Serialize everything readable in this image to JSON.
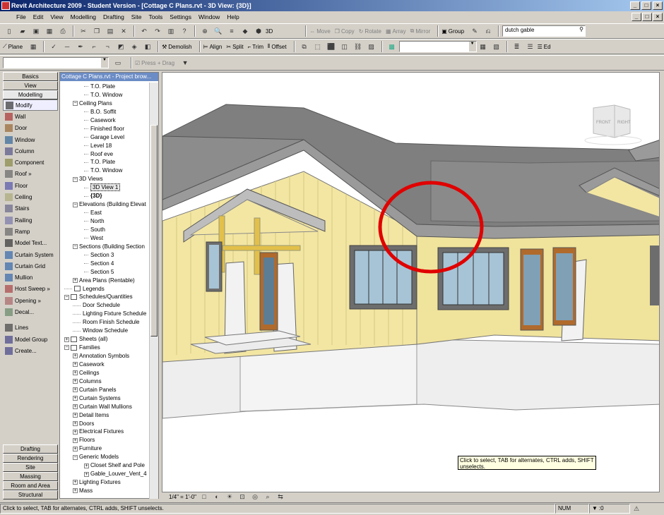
{
  "window": {
    "title": "Revit Architecture 2009 - Student Version - [Cottage C Plans.rvt - 3D View: {3D}]"
  },
  "menu": [
    "File",
    "Edit",
    "View",
    "Modelling",
    "Drafting",
    "Site",
    "Tools",
    "Settings",
    "Window",
    "Help"
  ],
  "toolbar1": {
    "view3d_label": "3D",
    "move": "Move",
    "copy": "Copy",
    "rotate": "Rotate",
    "array": "Array",
    "mirror": "Mirror",
    "group": "Group",
    "search_value": "dutch gable"
  },
  "toolbar2": {
    "plane": "Plane",
    "demolish": "Demolish",
    "align": "Align",
    "split": "Split",
    "trim": "Trim",
    "offset": "Offset",
    "ed": "Ed"
  },
  "toolbar3": {
    "press_drag": "Press + Drag"
  },
  "design_bar": {
    "top_tabs": [
      "Basics",
      "View",
      "Modelling"
    ],
    "items": [
      "Modify",
      "Wall",
      "Door",
      "Window",
      "Column",
      "Component",
      "Roof »",
      "Floor",
      "Ceiling",
      "Stairs",
      "Railing",
      "Ramp",
      "Model Text...",
      "Curtain System",
      "Curtain Grid",
      "Mullion",
      "Host Sweep »",
      "Opening »",
      "Decal...",
      "Lines",
      "Model Group",
      "Create..."
    ],
    "bottom_tabs": [
      "Drafting",
      "Rendering",
      "Site",
      "Massing",
      "Room and Area",
      "Structural"
    ]
  },
  "browser": {
    "header": "Cottage C Plans.rvt - Project brow...",
    "nodes": [
      {
        "t": "T.O. Plate",
        "l": 3
      },
      {
        "t": "T.O. Window",
        "l": 3
      },
      {
        "t": "Ceiling Plans",
        "l": 2,
        "e": "−"
      },
      {
        "t": "B.O. Soffit",
        "l": 3
      },
      {
        "t": "Casework",
        "l": 3
      },
      {
        "t": "Finished floor",
        "l": 3
      },
      {
        "t": "Garage Level",
        "l": 3
      },
      {
        "t": "Level 18",
        "l": 3
      },
      {
        "t": "Roof eve",
        "l": 3
      },
      {
        "t": "T.O. Plate",
        "l": 3
      },
      {
        "t": "T.O. Window",
        "l": 3
      },
      {
        "t": "3D Views",
        "l": 2,
        "e": "−"
      },
      {
        "t": "3D View 1",
        "l": 3,
        "sel": true
      },
      {
        "t": "{3D}",
        "l": 3,
        "bold": true
      },
      {
        "t": "Elevations (Building Elevat",
        "l": 2,
        "e": "−"
      },
      {
        "t": "East",
        "l": 3
      },
      {
        "t": "North",
        "l": 3
      },
      {
        "t": "South",
        "l": 3
      },
      {
        "t": "West",
        "l": 3
      },
      {
        "t": "Sections (Building Section",
        "l": 2,
        "e": "−"
      },
      {
        "t": "Section 3",
        "l": 3
      },
      {
        "t": "Section 4",
        "l": 3
      },
      {
        "t": "Section 5",
        "l": 3
      },
      {
        "t": "Area Plans (Rentable)",
        "l": 2,
        "e": "+"
      },
      {
        "t": "Legends",
        "l": 1,
        "icon": true
      },
      {
        "t": "Schedules/Quantities",
        "l": 1,
        "e": "−",
        "icon": true
      },
      {
        "t": "Door Schedule",
        "l": 2
      },
      {
        "t": "Lighting Fixture Schedule",
        "l": 2
      },
      {
        "t": "Room Finish Schedule",
        "l": 2
      },
      {
        "t": "Window Schedule",
        "l": 2
      },
      {
        "t": "Sheets (all)",
        "l": 1,
        "e": "+",
        "icon": true
      },
      {
        "t": "Families",
        "l": 1,
        "e": "−",
        "icon": true
      },
      {
        "t": "Annotation Symbols",
        "l": 2,
        "e": "+"
      },
      {
        "t": "Casework",
        "l": 2,
        "e": "+"
      },
      {
        "t": "Ceilings",
        "l": 2,
        "e": "+"
      },
      {
        "t": "Columns",
        "l": 2,
        "e": "+"
      },
      {
        "t": "Curtain Panels",
        "l": 2,
        "e": "+"
      },
      {
        "t": "Curtain Systems",
        "l": 2,
        "e": "+"
      },
      {
        "t": "Curtain Wall Mullions",
        "l": 2,
        "e": "+"
      },
      {
        "t": "Detail Items",
        "l": 2,
        "e": "+"
      },
      {
        "t": "Doors",
        "l": 2,
        "e": "+"
      },
      {
        "t": "Electrical Fixtures",
        "l": 2,
        "e": "+"
      },
      {
        "t": "Floors",
        "l": 2,
        "e": "+"
      },
      {
        "t": "Furniture",
        "l": 2,
        "e": "+"
      },
      {
        "t": "Generic Models",
        "l": 2,
        "e": "−"
      },
      {
        "t": "Closet Shelf and Pole",
        "l": 3,
        "e": "+"
      },
      {
        "t": "Gable_Louver_Vent_4",
        "l": 3,
        "e": "+"
      },
      {
        "t": "Lighting Fixtures",
        "l": 2,
        "e": "+"
      },
      {
        "t": "Mass",
        "l": 2,
        "e": "+"
      }
    ]
  },
  "view": {
    "viewcube_front": "FRONT",
    "viewcube_right": "RIGHT",
    "scale": "1/4\" = 1'-0\"",
    "tooltip": "Click to select, TAB for alternates, CTRL adds, SHIFT unselects."
  },
  "status": {
    "message": "Click to select, TAB for alternates, CTRL adds, SHIFT unselects.",
    "num": "NUM",
    "filter": ":0"
  },
  "colors": {
    "title_start": "#0a246a",
    "title_end": "#a6caf0",
    "wall": "#f3e6a3",
    "roof": "#8a8a8a",
    "highlight": "#e00000"
  }
}
